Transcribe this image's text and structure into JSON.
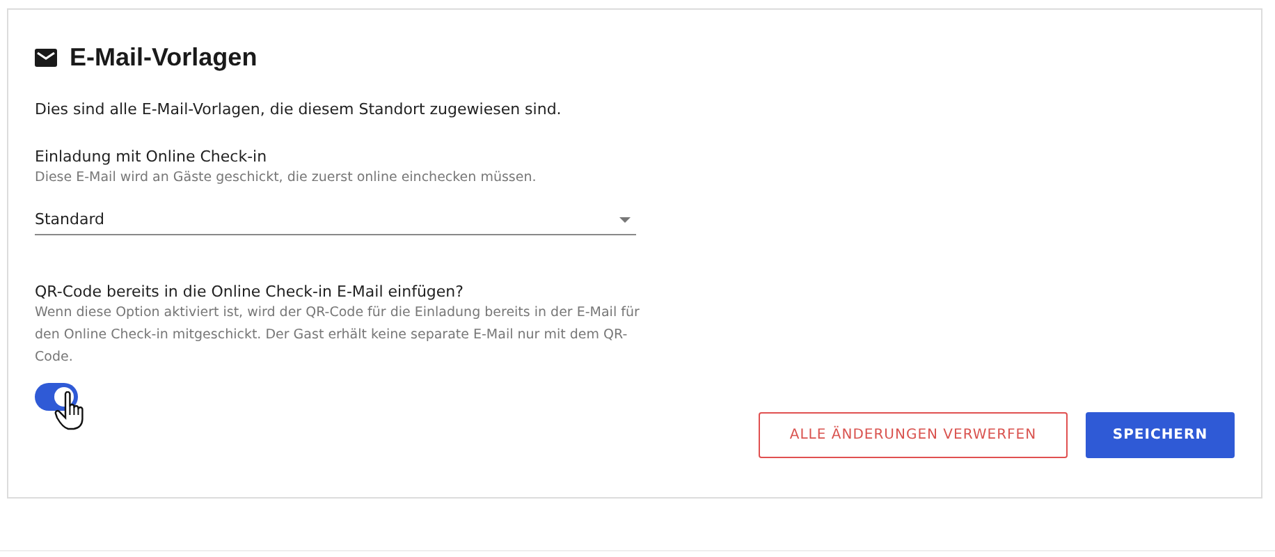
{
  "title": "E-Mail-Vorlagen",
  "description": "Dies sind alle E-Mail-Vorlagen, die diesem Standort zugewiesen sind.",
  "invitation": {
    "label": "Einladung mit Online Check-in",
    "hint": "Diese E-Mail wird an Gäste geschickt, die zuerst online einchecken müssen.",
    "value": "Standard"
  },
  "qr_option": {
    "label": "QR-Code bereits in die Online Check-in E-Mail einfügen?",
    "hint": "Wenn diese Option aktiviert ist, wird der QR-Code für die Einladung bereits in der E-Mail für den Online Check-in mitgeschickt. Der Gast erhält keine separate E-Mail nur mit dem QR-Code.",
    "on": true
  },
  "buttons": [
    {
      "label": "ALLE ÄNDERUNGEN VERWERFEN",
      "kind": "outline"
    },
    {
      "label": "SPEICHERN",
      "kind": "primary"
    }
  ]
}
